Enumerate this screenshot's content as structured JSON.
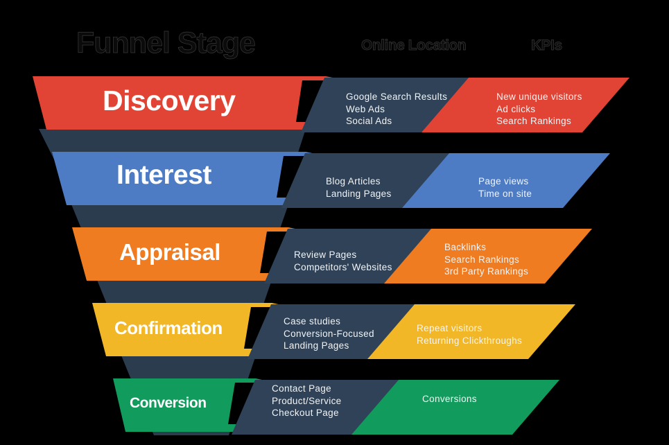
{
  "headers": {
    "stage": "Funnel Stage",
    "location": "Online Location",
    "kpis": "KPIs"
  },
  "colors": {
    "background": "#000000",
    "slate": "#2f4257",
    "slate_shadow": "#2b3c4f",
    "text_light": "#f2f4f6",
    "discovery": "#e14434",
    "interest": "#4e7cc4",
    "appraisal": "#f07c22",
    "confirmation": "#f2b727",
    "conversion": "#119b5c"
  },
  "rows": [
    {
      "stage": "Discovery",
      "color": "#e14434",
      "locations": [
        "Google Search Results",
        "Web Ads",
        "Social Ads"
      ],
      "kpis": [
        "New unique visitors",
        "Ad clicks",
        "Search Rankings"
      ]
    },
    {
      "stage": "Interest",
      "color": "#4e7cc4",
      "locations": [
        "Blog Articles",
        "Landing Pages"
      ],
      "kpis": [
        "Page views",
        "Time on site"
      ]
    },
    {
      "stage": "Appraisal",
      "color": "#f07c22",
      "locations": [
        "Review Pages",
        "Competitors' Websites"
      ],
      "kpis": [
        "Backlinks",
        "Search Rankings",
        "3rd Party Rankings"
      ]
    },
    {
      "stage": "Confirmation",
      "color": "#f2b727",
      "locations": [
        "Case studies",
        "Conversion-Focused",
        "Landing Pages"
      ],
      "kpis": [
        "Repeat visitors",
        "Returning Clickthroughs"
      ]
    },
    {
      "stage": "Conversion",
      "color": "#119b5c",
      "locations": [
        "Contact Page",
        "Product/Service",
        "Checkout Page"
      ],
      "kpis": [
        "Conversions"
      ]
    }
  ]
}
